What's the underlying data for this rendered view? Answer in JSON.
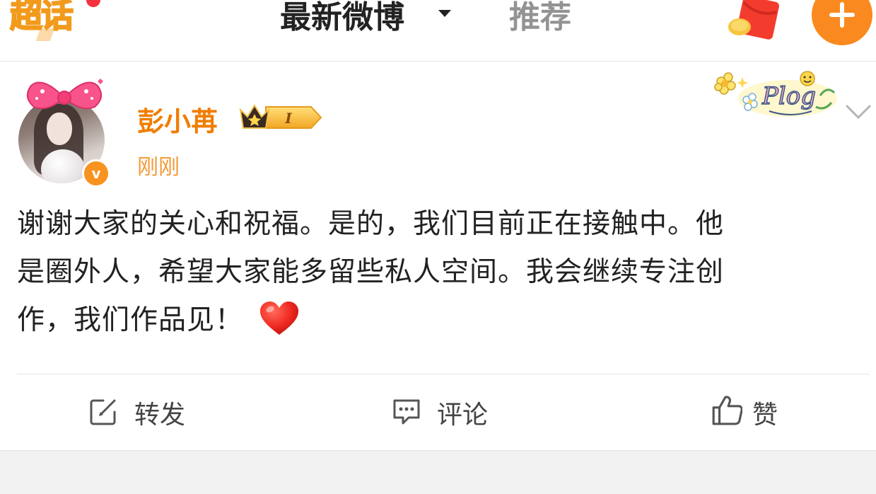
{
  "topbar": {
    "supertopic_label": "超话",
    "tabs": [
      {
        "label": "最新微博",
        "active": true
      },
      {
        "label": "推荐",
        "active": false
      }
    ],
    "accent_color": "#f7a02a"
  },
  "post": {
    "author": "彭小苒",
    "member_badge_level": "I",
    "timestamp": "刚刚",
    "verified_icon": "v-verified-icon",
    "sticker_text": "Plog",
    "text_lines": [
      "谢谢大家的关心和祝福。是的，我们目前正在接触中。他",
      "是圈外人，希望大家能多留些私人空间。我会继续专注创",
      "作，我们作品见！"
    ],
    "emoji": "heart-emoji",
    "actions": {
      "repost": "转发",
      "comment": "评论",
      "like": "赞"
    }
  }
}
